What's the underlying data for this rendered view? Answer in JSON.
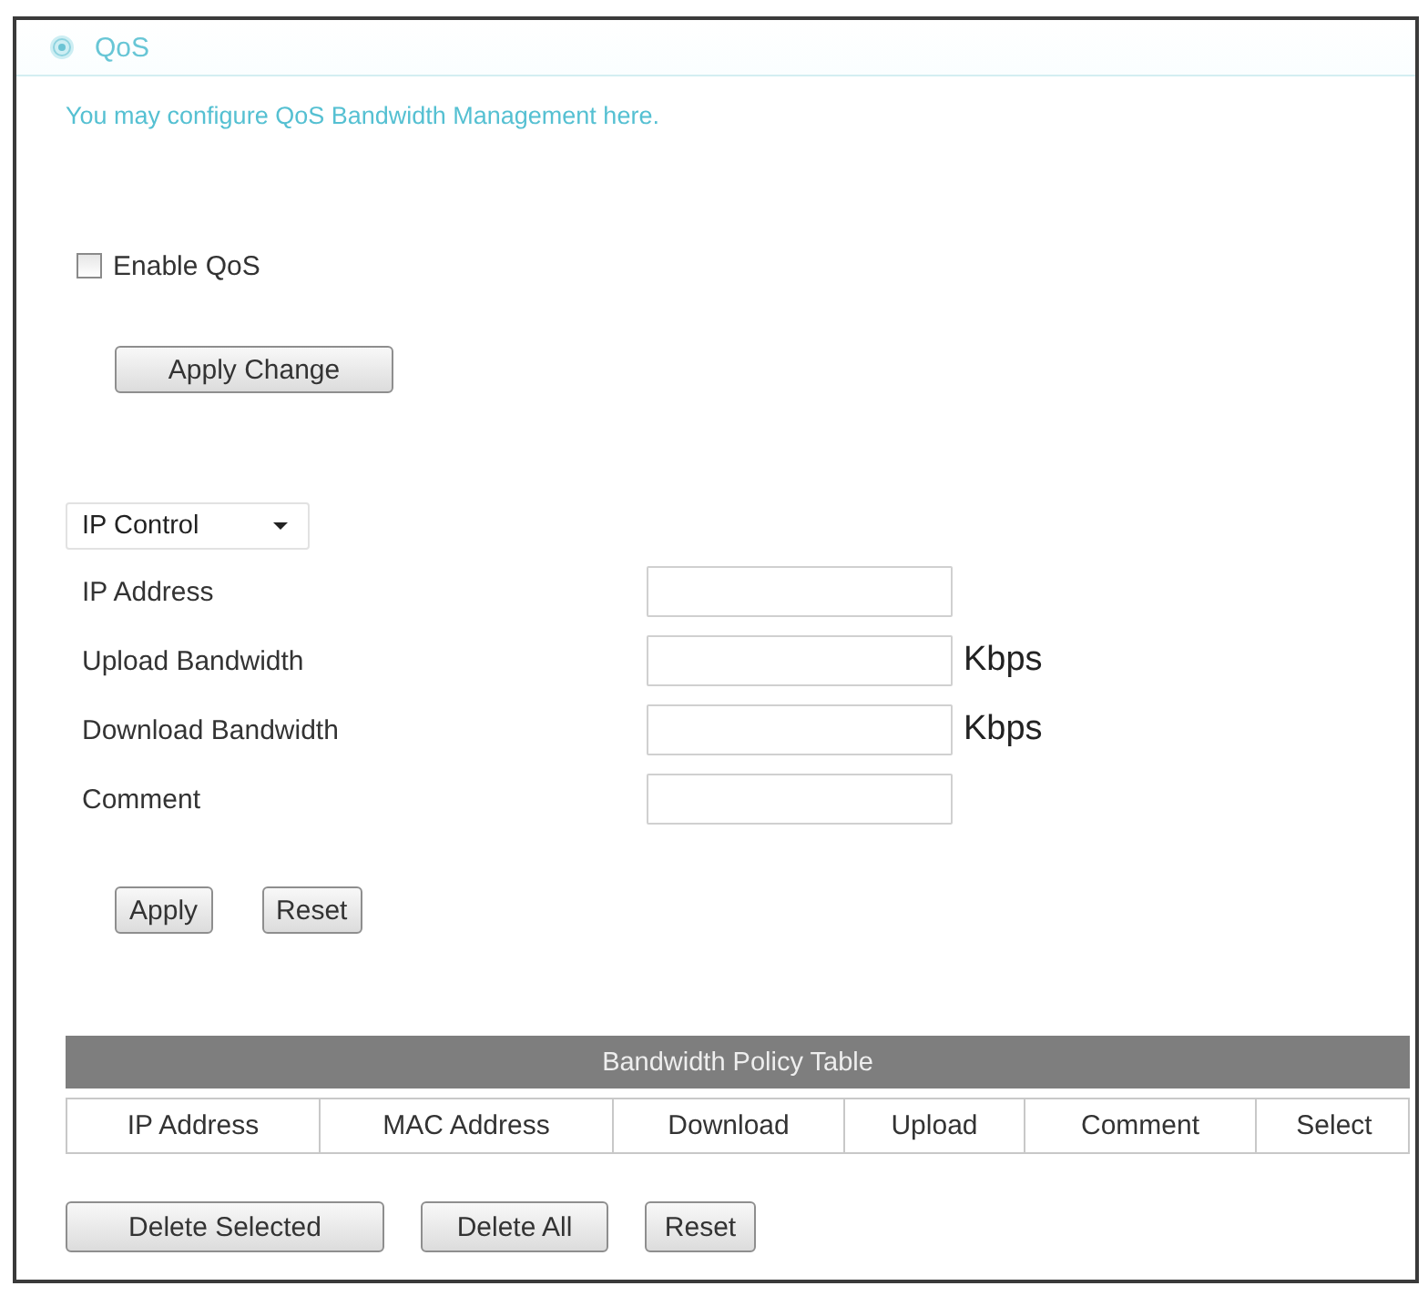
{
  "header": {
    "title": "QoS",
    "description": "You may configure QoS Bandwidth Management here."
  },
  "enable": {
    "label": "Enable QoS",
    "checked": false
  },
  "apply_change": {
    "label": "Apply Change"
  },
  "mode_select": {
    "value": "IP Control"
  },
  "fields": [
    {
      "label": "IP Address"
    },
    {
      "label": "Upload Bandwidth",
      "unit": "Kbps"
    },
    {
      "label": "Download Bandwidth",
      "unit": "Kbps"
    },
    {
      "label": "Comment"
    }
  ],
  "form_buttons": [
    "Apply",
    "Reset"
  ],
  "policy_table": {
    "title": "Bandwidth Policy Table",
    "columns": [
      "IP Address",
      "MAC Address",
      "Download",
      "Upload",
      "Comment",
      "Select"
    ]
  },
  "table_buttons": [
    "Delete Selected",
    "Delete All",
    "Reset"
  ]
}
